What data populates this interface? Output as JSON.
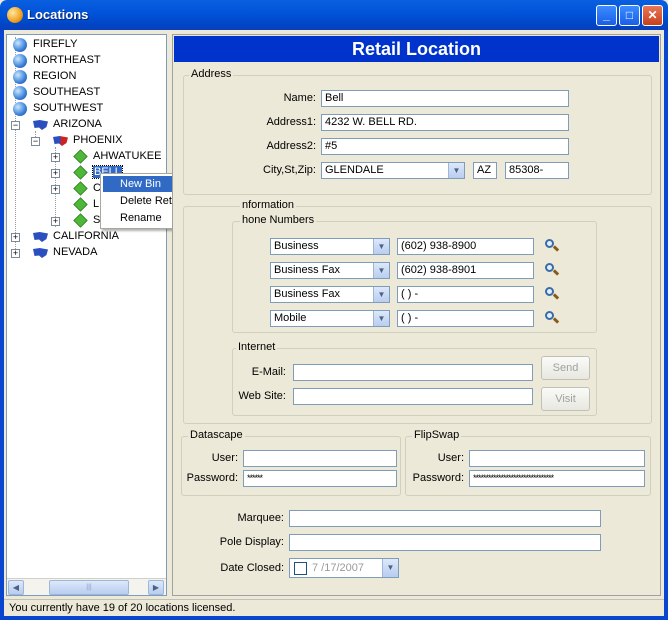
{
  "window": {
    "title": "Locations",
    "buttons": {
      "minimize": "_",
      "maximize": "□",
      "close": "✕"
    }
  },
  "tree": {
    "nodes": [
      {
        "label": "FIREFLY",
        "icon": "globe-icon"
      },
      {
        "label": "NORTHEAST",
        "icon": "globe-icon"
      },
      {
        "label": "REGION",
        "icon": "globe-icon"
      },
      {
        "label": "SOUTHEAST",
        "icon": "globe-icon"
      },
      {
        "label": "SOUTHWEST",
        "icon": "globe-icon"
      },
      {
        "label": "ARIZONA",
        "icon": "us-map-icon",
        "expanded": true
      },
      {
        "label": "PHOENIX",
        "icon": "city-map-icon",
        "expanded": true
      },
      {
        "label": "AHWATUKEE",
        "icon": "location-icon"
      },
      {
        "label": "BELL",
        "icon": "location-icon",
        "selected": true
      },
      {
        "label": "C",
        "icon": "location-icon"
      },
      {
        "label": "L",
        "icon": "location-icon"
      },
      {
        "label": "S",
        "icon": "location-icon"
      },
      {
        "label": "CALIFORNIA",
        "icon": "us-map-icon"
      },
      {
        "label": "NEVADA",
        "icon": "us-map-icon"
      }
    ]
  },
  "context_menu": {
    "items": [
      "New Bin",
      "Delete Retail Location",
      "Rename"
    ],
    "highlighted": "New Bin"
  },
  "header": {
    "title": "Retail Location"
  },
  "address": {
    "group_label": "Address",
    "name_label": "Name:",
    "name": "Bell",
    "address1_label": "Address1:",
    "address1": "4232 W. BELL RD.",
    "address2_label": "Address2:",
    "address2": "#5",
    "citystzip_label": "City,St,Zip:",
    "city": "GLENDALE",
    "state": "AZ",
    "zip": "85308-"
  },
  "information": {
    "group_label": "nformation",
    "phones_label": "hone Numbers",
    "phones": [
      {
        "type": "Business",
        "number": "(602) 938-8900"
      },
      {
        "type": "Business Fax",
        "number": "(602) 938-8901"
      },
      {
        "type": "Business Fax",
        "number": "(   )    -"
      },
      {
        "type": "Mobile",
        "number": "(   )    -"
      }
    ],
    "internet_label": "Internet",
    "email_label": "E-Mail:",
    "email": "",
    "website_label": "Web Site:",
    "website": "",
    "send_label": "Send",
    "visit_label": "Visit"
  },
  "datascape": {
    "group_label": "Datascape",
    "user_label": "User:",
    "user": "",
    "password_label": "Password:",
    "password": "******"
  },
  "flipswap": {
    "group_label": "FlipSwap",
    "user_label": "User:",
    "user": "",
    "password_label": "Password:",
    "password": "********************************"
  },
  "marquee": {
    "label": "Marquee:",
    "value": ""
  },
  "pole_display": {
    "label": "Pole Display:",
    "value": ""
  },
  "date_closed": {
    "label": "Date Closed:",
    "value": "7 /17/2007",
    "checked": false
  },
  "status": {
    "text": "You currently have 19 of 20 locations licensed."
  }
}
